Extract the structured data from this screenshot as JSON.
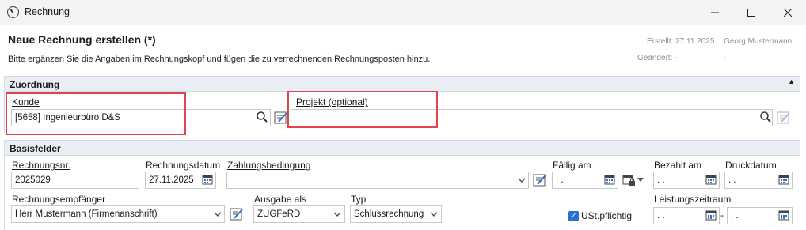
{
  "window": {
    "title": "Rechnung"
  },
  "header": {
    "heading": "Neue Rechnung erstellen (*)",
    "subtext": "Bitte ergänzen Sie die Angaben im Rechnungskopf und fügen die zu verrechnenden Rechnungsposten hinzu.",
    "created_label": "Erstellt: 27.11.2025",
    "created_by": "Georg Mustermann",
    "changed_label": "Geändert: -",
    "changed_by": "-"
  },
  "zuordnung": {
    "section_title": "Zuordnung",
    "kunde_label": "Kunde",
    "kunde_value": "[5658] Ingenieurbüro D&S",
    "projekt_label": "Projekt (optional)",
    "projekt_value": ""
  },
  "basisfelder": {
    "section_title": "Basisfelder",
    "rechnungsnr_label": "Rechnungsnr.",
    "rechnungsnr_value": "2025029",
    "rechnungsdatum_label": "Rechnungsdatum",
    "rechnungsdatum_value": "27.11.2025",
    "zahlungsbedingung_label": "Zahlungsbedingung",
    "zahlungsbedingung_value": "",
    "faellig_label": "Fällig am",
    "faellig_value": ". .",
    "bezahlt_label": "Bezahlt am",
    "bezahlt_value": ". .",
    "druckdatum_label": "Druckdatum",
    "druckdatum_value": ". .",
    "empfaenger_label": "Rechnungsempfänger",
    "empfaenger_value": "Herr Mustermann (Firmenanschrift)",
    "ausgabe_label": "Ausgabe als",
    "ausgabe_value": "ZUGFeRD",
    "typ_label": "Typ",
    "typ_value": "Schlussrechnung",
    "ust_label": "USt.pflichtig",
    "ust_checked": true,
    "leistungszeitraum_label": "Leistungszeitraum",
    "leistung_von": ". .",
    "leistung_dash": "-",
    "leistung_bis": ". ."
  },
  "colors": {
    "highlight": "#e0454f",
    "section_bg": "#e9eef4",
    "checkbox": "#2a6fcf"
  }
}
